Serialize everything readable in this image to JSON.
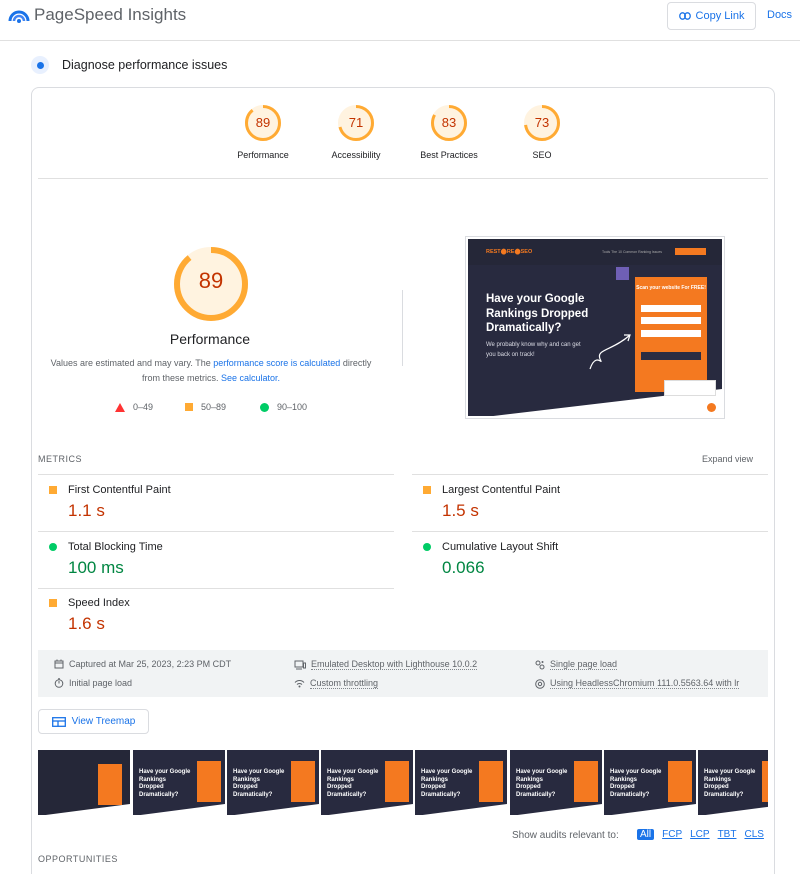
{
  "header": {
    "brand": "PageSpeed Insights",
    "copy_link": "Copy Link",
    "docs": "Docs"
  },
  "section": {
    "title": "Diagnose performance issues"
  },
  "summary_scores": [
    {
      "label": "Performance",
      "score": "89",
      "fraction": 0.89
    },
    {
      "label": "Accessibility",
      "score": "71",
      "fraction": 0.71
    },
    {
      "label": "Best Practices",
      "score": "83",
      "fraction": 0.83
    },
    {
      "label": "SEO",
      "score": "73",
      "fraction": 0.73
    }
  ],
  "main_score": {
    "score": "89",
    "fraction": 0.89,
    "label": "Performance",
    "note_1": "Values are estimated and may vary. The ",
    "note_link_1": "performance score is calculated",
    "note_2": " directly from these metrics. ",
    "note_link_2": "See calculator."
  },
  "legend": [
    {
      "range": "0–49",
      "color": "#f33"
    },
    {
      "range": "50–89",
      "color": "#fa3"
    },
    {
      "range": "90–100",
      "color": "#0c6"
    }
  ],
  "preview": {
    "logo": "REST⬤RE⬤SEO",
    "nav": "Tools    The 10 Common Ranking Issues",
    "headline": "Have your Google Rankings Dropped Dramatically?",
    "sub": "We probably know why and can get you back on track!",
    "form_title": "Scan your website For FREE!"
  },
  "metrics": {
    "heading": "METRICS",
    "expand": "Expand view",
    "items": [
      {
        "name": "First Contentful Paint",
        "value": "1.1 s",
        "status": "average"
      },
      {
        "name": "Largest Contentful Paint",
        "value": "1.5 s",
        "status": "average"
      },
      {
        "name": "Total Blocking Time",
        "value": "100 ms",
        "status": "pass"
      },
      {
        "name": "Cumulative Layout Shift",
        "value": "0.066",
        "status": "pass"
      },
      {
        "name": "Speed Index",
        "value": "1.6 s",
        "status": "average"
      }
    ]
  },
  "info": {
    "captured": "Captured at Mar 25, 2023, 2:23 PM CDT",
    "emulated": "Emulated Desktop with Lighthouse 10.0.2",
    "single": "Single page load",
    "initial": "Initial page load",
    "throttling": "Custom throttling",
    "browser": "Using HeadlessChromium 111.0.5563.64 with lr"
  },
  "treemap": {
    "label": "View Treemap"
  },
  "filmstrip": {
    "frame_headline": "Have your Google Rankings Dropped Dramatically?"
  },
  "audits": {
    "relevant_label": "Show audits relevant to:",
    "filters": [
      "All",
      "FCP",
      "LCP",
      "TBT",
      "CLS"
    ]
  },
  "opportunities": {
    "heading": "OPPORTUNITIES"
  },
  "colors": {
    "accent": "#1a73e8",
    "average": "#fa3",
    "pass": "#0c6",
    "fail": "#f33",
    "average_text": "#c33300",
    "pass_text": "#018642"
  }
}
